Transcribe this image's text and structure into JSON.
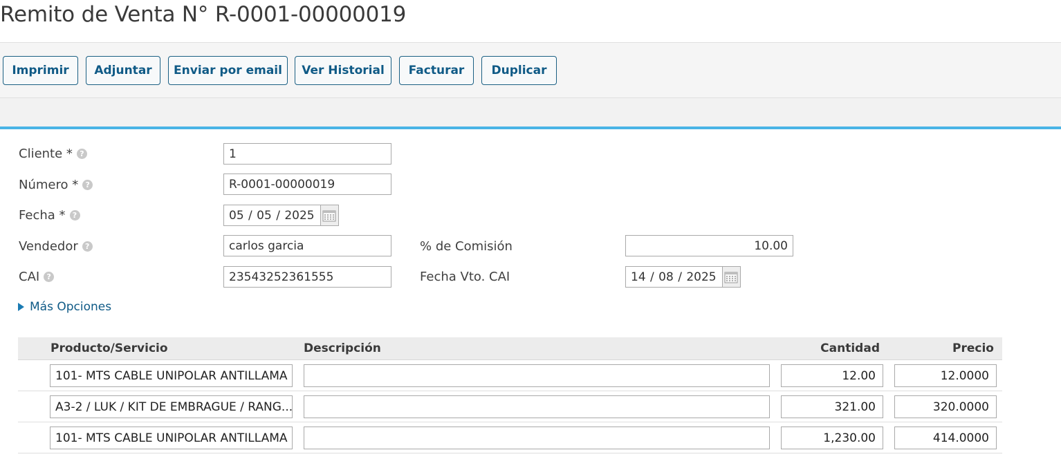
{
  "header": {
    "title": "Remito de Venta N° R-0001-00000019"
  },
  "toolbar": {
    "buttons": [
      {
        "label": "Imprimir"
      },
      {
        "label": "Adjuntar"
      },
      {
        "label": "Enviar por email"
      },
      {
        "label": "Ver Historial"
      },
      {
        "label": "Facturar"
      },
      {
        "label": "Duplicar"
      }
    ]
  },
  "form": {
    "cliente": {
      "label": "Cliente *",
      "value": "1"
    },
    "numero": {
      "label": "Número *",
      "value": "R-0001-00000019"
    },
    "fecha": {
      "label": "Fecha *",
      "value": "05 /  05 /   2025"
    },
    "vendedor": {
      "label": "Vendedor",
      "value": "carlos garcia"
    },
    "comision": {
      "label": "% de Comisión",
      "value": "10.00"
    },
    "cai": {
      "label": "CAI",
      "value": "23543252361555"
    },
    "fecha_vto_cai": {
      "label": "Fecha Vto. CAI",
      "value": "14 /  08 /   2025"
    },
    "more_options": "Más Opciones"
  },
  "table": {
    "headers": {
      "producto": "Producto/Servicio",
      "descripcion": "Descripción",
      "cantidad": "Cantidad",
      "precio": "Precio"
    },
    "rows": [
      {
        "producto": "101- MTS CABLE UNIPOLAR ANTILLAMA",
        "descripcion": "",
        "cantidad": "12.00",
        "precio": "12.0000"
      },
      {
        "producto": "A3-2 / LUK / KIT DE EMBRAGUE / RANG...",
        "descripcion": "",
        "cantidad": "321.00",
        "precio": "320.0000"
      },
      {
        "producto": "101- MTS CABLE UNIPOLAR ANTILLAMA",
        "descripcion": "",
        "cantidad": "1,230.00",
        "precio": "414.0000"
      }
    ]
  },
  "icons": {
    "help": "help-circle-icon",
    "calendar": "calendar-icon",
    "expand": "triangle-right-icon"
  },
  "colors": {
    "accent": "#4ab4e6",
    "button_text": "#0f5a86",
    "button_border": "#1a5f83"
  }
}
